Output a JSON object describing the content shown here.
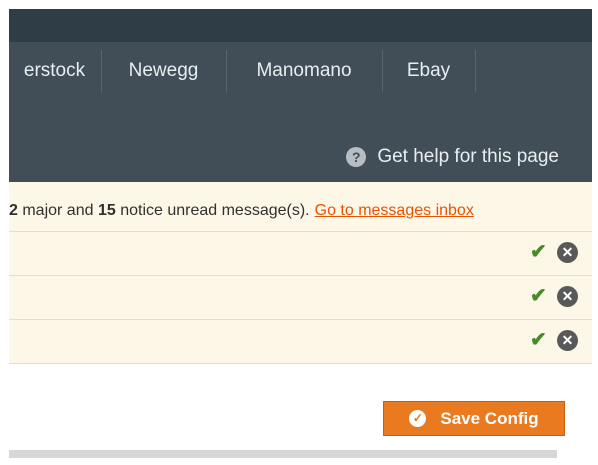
{
  "nav": {
    "tabs": [
      {
        "label": "erstock"
      },
      {
        "label": "Newegg"
      },
      {
        "label": "Manomano"
      },
      {
        "label": "Ebay"
      }
    ]
  },
  "help": {
    "icon": "question-circle-icon",
    "label": "Get help for this page"
  },
  "messages": {
    "major_count": "2",
    "text_a": " major and ",
    "notice_count": "15",
    "text_b": " notice unread message(s).",
    "link": "Go to messages inbox",
    "rows": [
      {
        "check_icon": "✔",
        "close_icon": "✕"
      },
      {
        "check_icon": "✔",
        "close_icon": "✕"
      },
      {
        "check_icon": "✔",
        "close_icon": "✕"
      }
    ]
  },
  "actions": {
    "save_label": "Save Config",
    "save_icon": "✓"
  },
  "colors": {
    "topbar": "#2f3d46",
    "nav": "#414e57",
    "message_bg": "#fdf7e8",
    "accent": "#eb5202",
    "save_button": "#ea7a20"
  }
}
